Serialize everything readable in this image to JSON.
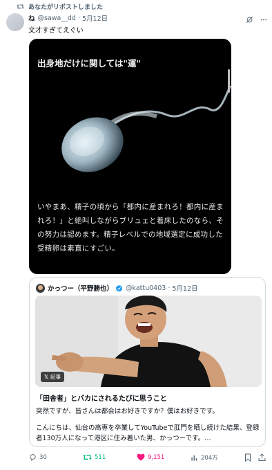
{
  "repost": {
    "label": "あなたがリポストしました",
    "icon": "repost-icon"
  },
  "author": {
    "name": "ね",
    "handle": "@sawa__dd",
    "separator": "·",
    "date": "5月12日"
  },
  "tweet": {
    "text": "文才すぎてえぐい"
  },
  "media": {
    "title": "出身地だけに関しては\"運\"",
    "body": "いやまあ、精子の頃から「都内に産まれろ！都内に産まれろ！」と絶叫しながらブリュェと着床したのなら、その努力は認めます。精子レベルでの地域選定に成功した受精卵は素直にすごい。"
  },
  "quote": {
    "name": "かっつー（平野勝也）",
    "handle": "@kattu0403",
    "separator": "·",
    "date": "5月12日",
    "badge_x": "𝕏",
    "badge_label": "記事",
    "article_title": "「田舎者」とバカにされるたびに思うこと",
    "article_subtitle": "突然ですが、皆さんは都会はお好きですか？僕はお好きです。",
    "article_body": "こんにちは、仙台の高専を卒業してYouTubeで肛門を晒し続けた結果、登録者130万人になって港区に住み着いた男、かっつーです。…"
  },
  "actions": {
    "replies": "30",
    "reposts": "511",
    "likes": "9,151",
    "views": "204万"
  },
  "colors": {
    "text": "#0f1419",
    "secondary": "#536471",
    "retweet": "#00ba7c",
    "like": "#f91880",
    "verified": "#1d9bf0",
    "border": "#cfd9de"
  }
}
